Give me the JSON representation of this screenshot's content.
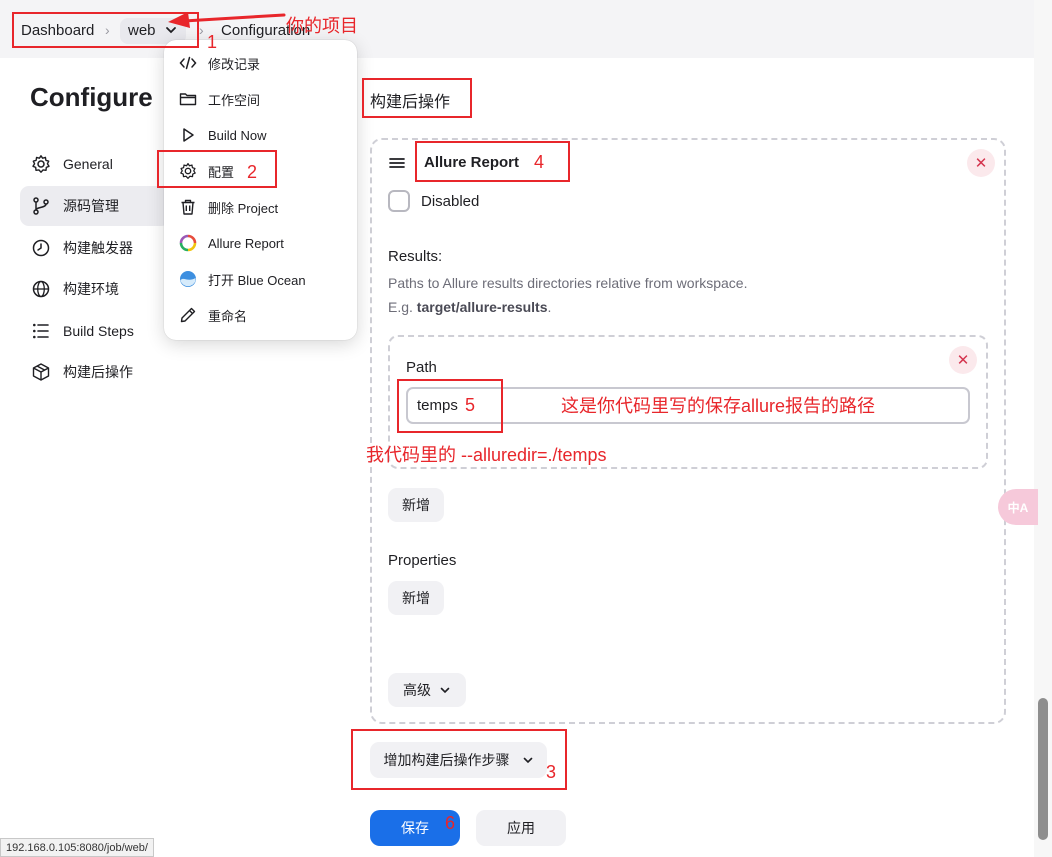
{
  "breadcrumbs": {
    "dashboard": "Dashboard",
    "job": "web",
    "current": "Configuration"
  },
  "page": {
    "title": "Configure"
  },
  "sidebar": {
    "items": [
      {
        "label": "General",
        "icon": "gear-icon"
      },
      {
        "label": "源码管理",
        "icon": "branch-icon"
      },
      {
        "label": "构建触发器",
        "icon": "timer-icon"
      },
      {
        "label": "构建环境",
        "icon": "globe-icon"
      },
      {
        "label": "Build Steps",
        "icon": "list-icon"
      },
      {
        "label": "构建后操作",
        "icon": "package-icon"
      }
    ]
  },
  "dropdown": {
    "items": [
      {
        "label": "修改记录",
        "icon": "code-icon"
      },
      {
        "label": "工作空间",
        "icon": "folder-icon"
      },
      {
        "label": "Build Now",
        "icon": "play-icon"
      },
      {
        "label": "配置",
        "icon": "gear-icon"
      },
      {
        "label": "删除 Project",
        "icon": "trash-icon"
      },
      {
        "label": "Allure Report",
        "icon": "allure-logo-icon"
      },
      {
        "label": "打开 Blue Ocean",
        "icon": "blue-ocean-icon"
      },
      {
        "label": "重命名",
        "icon": "pencil-icon"
      }
    ]
  },
  "post_build": {
    "section_title": "构建后操作",
    "card_title": "Allure Report",
    "disabled_label": "Disabled",
    "results_label": "Results:",
    "results_desc_line1": "Paths to Allure results directories relative from workspace.",
    "results_desc_prefix": "E.g. ",
    "results_desc_example": "target/allure-results",
    "results_desc_suffix": ".",
    "path_label": "Path",
    "path_value": "temps",
    "add_path_button": "新增",
    "properties_label": "Properties",
    "add_property_button": "新增",
    "advanced_button": "高级",
    "add_step_button": "增加构建后操作步骤"
  },
  "footer": {
    "save_button": "保存",
    "apply_button": "应用"
  },
  "status_url": "192.168.0.105:8080/job/web/",
  "translate_fab": "中A",
  "annotations": {
    "project_note": "你的项目",
    "path_note": "这是你代码里写的保存allure报告的路径",
    "cmd_note": "我代码里的 --alluredir=./temps",
    "n1": "1",
    "n2": "2",
    "n3": "3",
    "n4": "4",
    "n5": "5",
    "n6": "6"
  },
  "colors": {
    "annotation_red": "#e8262b",
    "primary_blue": "#1a6fe8",
    "close_red": "#d4344e"
  }
}
